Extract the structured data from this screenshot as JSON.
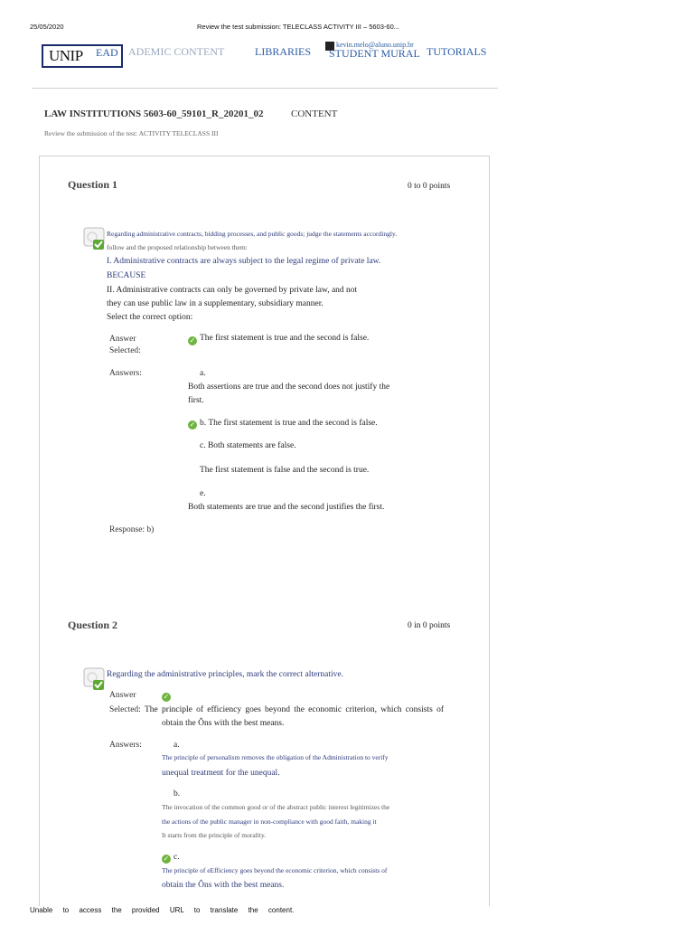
{
  "print_header": {
    "date": "25/05/2020",
    "title": "Review the test submission: TELECLASS ACTIVITY III – 5603-60..."
  },
  "nav": {
    "logo": "UNIP",
    "logo_ead": "EAD",
    "academic": "ADEMIC CONTENT",
    "libraries": "LIBRARIES",
    "student_mural": "STUDENT MURAL",
    "user_email": "kevin.melo@aluno.unip.br",
    "tutorials": "TUTORIALS"
  },
  "course": {
    "title": "LAW INSTITUTIONS 5603-60_59101_R_20201_02",
    "content_label": "CONTENT",
    "subtitle": "Review the submission of the test: ACTIVITY TELECLASS III"
  },
  "q1": {
    "title": "Question 1",
    "points": "0 to 0 points",
    "prompt1": "Regarding administrative contracts, bidding processes, and public goods; judge the statements accordingly.",
    "prompt2": "follow and the proposed relationship between them:",
    "stmt1": "I. Administrative contracts are always subject to the legal regime of private law.",
    "because": "BECAUSE",
    "stmt2a": "II. Administrative contracts can only be governed by private law, and not",
    "stmt2b": "they can use public law in a supplementary, subsidiary manner.",
    "select": "Select the correct option:",
    "answer_label1": "Answer",
    "answer_label2": "Selected:",
    "selected": "The first statement is true and the second is false.",
    "answers_label": "Answers:",
    "opt_a_letter": "a.",
    "opt_a_1": "Both assertions are true and the second does not justify the",
    "opt_a_2": "first.",
    "opt_b": "b. The first statement is true and the second is false.",
    "opt_c": "c. Both statements are false.",
    "opt_d": "The first statement is false and the second is true.",
    "opt_e_letter": "e.",
    "opt_e": "Both statements are true and the second justifies the first.",
    "response": "Response: b)"
  },
  "q2": {
    "title": "Question 2",
    "points": "0 in 0 points",
    "prompt": "Regarding the administrative principles, mark the correct alternative.",
    "answer_label1": "Answer",
    "answer_label2": "Selected:",
    "selected_1": "The principle of efficiency goes beyond the economic criterion, which consists of",
    "selected_2": "obtain the Ôns with the best means.",
    "answers_label": "Answers:",
    "opt_a_letter": "a.",
    "opt_a_1": "The principle of personalism removes the obligation of the Administration to verify",
    "opt_a_2": "unequal treatment for the unequal.",
    "opt_b_letter": "b.",
    "opt_b_1": "The invocation of the common good or of the abstract public interest legitimizes the",
    "opt_b_2": "the actions of the public manager in non-compliance with good faith, making it",
    "opt_b_3": "It starts from the principle of morality.",
    "opt_c_letter": "c.",
    "opt_c_1": "The principle of eEfficiency goes beyond the economic criterion, which consists of",
    "opt_c_2": "obtain the Ôns with the best means."
  },
  "footer": "Unable to access the provided URL to translate the content."
}
